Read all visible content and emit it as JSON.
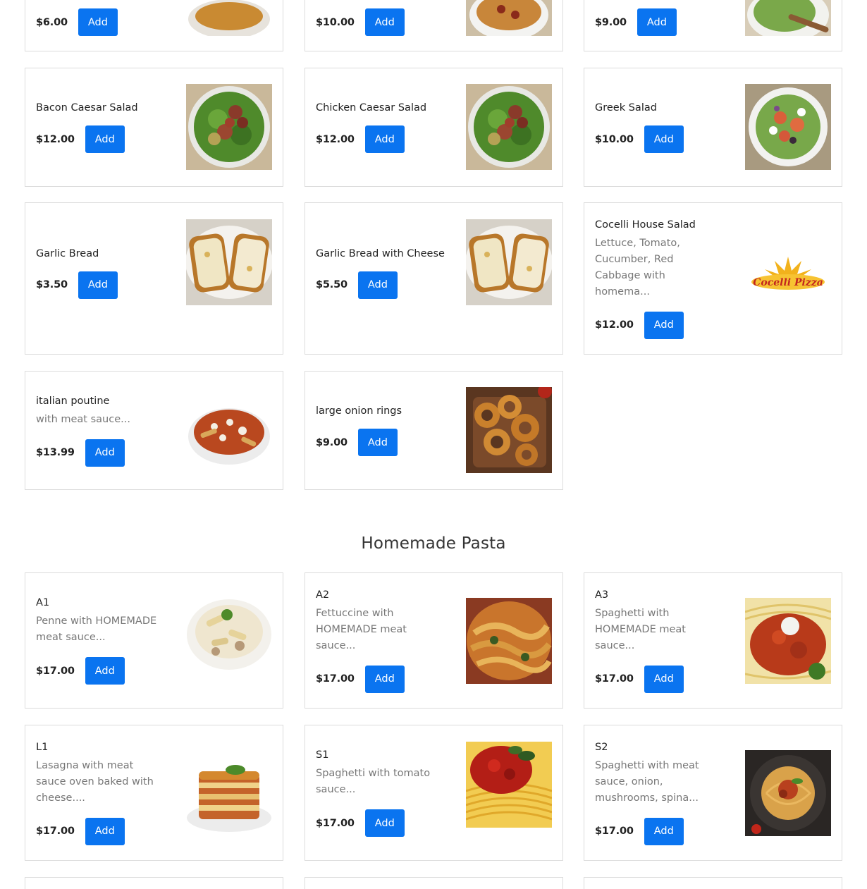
{
  "add_label": "Add",
  "top_row": [
    {
      "price": "$6.00"
    },
    {
      "price": "$10.00"
    },
    {
      "price": "$9.00"
    }
  ],
  "items": [
    {
      "name": "Bacon Caesar Salad",
      "price": "$12.00",
      "image": "caesar-salad"
    },
    {
      "name": "Chicken Caesar Salad",
      "price": "$12.00",
      "image": "caesar-salad"
    },
    {
      "name": "Greek Salad",
      "price": "$10.00",
      "image": "greek-salad"
    },
    {
      "name": "Garlic Bread",
      "price": "$3.50",
      "image": "garlic-bread"
    },
    {
      "name": "Garlic Bread with Cheese",
      "price": "$5.50",
      "image": "garlic-bread"
    },
    {
      "name": "Cocelli House Salad",
      "desc": "Lettuce, Tomato, Cucumber, Red Cabbage with homema...",
      "price": "$12.00",
      "image": "cocelli-logo"
    },
    {
      "name": "italian poutine",
      "desc": "with meat sauce...",
      "price": "$13.99",
      "image": "poutine"
    },
    {
      "name": "large onion rings",
      "price": "$9.00",
      "image": "onion-rings"
    }
  ],
  "logo_text": "Cocelli Pizza",
  "pasta_section": {
    "title": "Homemade Pasta",
    "items": [
      {
        "name": "A1",
        "desc": "Penne with HOMEMADE meat sauce...",
        "price": "$17.00",
        "image": "penne"
      },
      {
        "name": "A2",
        "desc": "Fettuccine with HOMEMADE meat sauce...",
        "price": "$17.00",
        "image": "fettuccine"
      },
      {
        "name": "A3",
        "desc": "Spaghetti with HOMEMADE meat sauce...",
        "price": "$17.00",
        "image": "spaghetti-meat"
      },
      {
        "name": "L1",
        "desc": "Lasagna with meat sauce oven baked with cheese....",
        "price": "$17.00",
        "image": "lasagna"
      },
      {
        "name": "S1",
        "desc": "Spaghetti with tomato sauce...",
        "price": "$17.00",
        "image": "spaghetti-tomato"
      },
      {
        "name": "S2",
        "desc": "Spaghetti with meat sauce, onion, mushrooms, spina...",
        "price": "$17.00",
        "image": "spaghetti-plate"
      }
    ]
  },
  "colors": {
    "accent": "#0a74f0",
    "border": "#dcdcdc",
    "muted_text": "#777777"
  }
}
